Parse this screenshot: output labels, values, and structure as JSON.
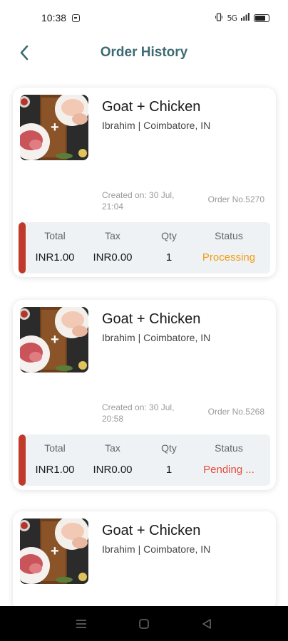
{
  "status_bar": {
    "time": "10:38",
    "network": "5G"
  },
  "header": {
    "title": "Order History"
  },
  "orders": [
    {
      "title": "Goat + Chicken",
      "subtitle": "Ibrahim | Coimbatore, IN",
      "created": "Created on: 30 Jul, 21:04",
      "order_no": "Order No.5270",
      "labels": {
        "total": "Total",
        "tax": "Tax",
        "qty": "Qty",
        "status": "Status"
      },
      "total": "INR1.00",
      "tax": "INR0.00",
      "qty": "1",
      "status": "Processing",
      "status_color": "#f39c12"
    },
    {
      "title": "Goat + Chicken",
      "subtitle": "Ibrahim | Coimbatore, IN",
      "created": "Created on: 30 Jul, 20:58",
      "order_no": "Order No.5268",
      "labels": {
        "total": "Total",
        "tax": "Tax",
        "qty": "Qty",
        "status": "Status"
      },
      "total": "INR1.00",
      "tax": "INR0.00",
      "qty": "1",
      "status": "Pending ...",
      "status_color": "#e74c3c"
    },
    {
      "title": "Goat + Chicken",
      "subtitle": "Ibrahim | Coimbatore, IN"
    }
  ],
  "colors": {
    "accent": "#3e6b73",
    "status_bar_marker": "#c0392b",
    "summary_bg": "#eef2f5"
  },
  "icons": {
    "back": "chevron-left-icon",
    "nav_menu": "menu-icon",
    "nav_home": "square-home-icon",
    "nav_back": "triangle-back-icon"
  }
}
